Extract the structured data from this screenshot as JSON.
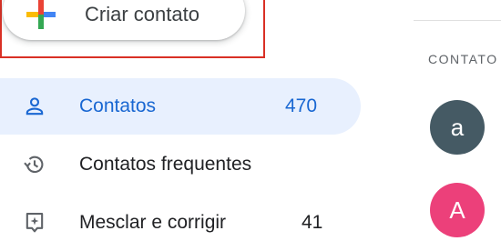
{
  "create_button": {
    "label": "Criar contato"
  },
  "section_header": "CONTATO",
  "nav": {
    "items": [
      {
        "label": "Contatos",
        "count": "470",
        "icon": "person-icon",
        "active": true
      },
      {
        "label": "Contatos frequentes",
        "count": "",
        "icon": "history-icon",
        "active": false
      },
      {
        "label": "Mesclar e corrigir",
        "count": "41",
        "icon": "merge-fix-icon",
        "active": false
      }
    ]
  },
  "avatars": [
    {
      "letter": "a",
      "color": "#455a64"
    },
    {
      "letter": "A",
      "color": "#ec407a"
    }
  ],
  "colors": {
    "accent": "#1967d2",
    "active_bg": "#e8f0fe",
    "highlight_border": "#d93025"
  }
}
